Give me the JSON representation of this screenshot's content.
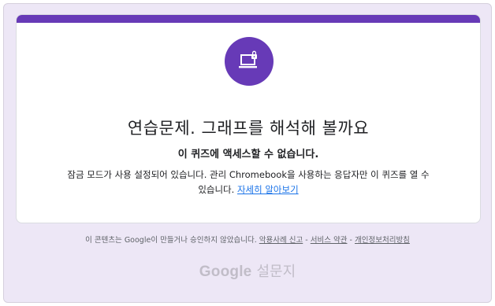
{
  "card": {
    "icon": "locked-laptop-icon",
    "title": "연습문제. 그래프를 해석해 볼까요",
    "subtitle": "이 퀴즈에 액세스할 수 없습니다.",
    "body_line1": "잠금 모드가 사용 설정되어 있습니다. 관리 Chromebook을 사용하는 응답자만 이 퀴즈를 열 수",
    "body_line2_prefix": "있습니다.",
    "learn_more": "자세히 알아보기"
  },
  "footer": {
    "notice": "이 콘텐츠는 Google이 만들거나 승인하지 않았습니다.",
    "report_abuse": "악용사례 신고",
    "sep1": "-",
    "terms": "서비스 약관",
    "sep2": "-",
    "privacy": "개인정보처리방침"
  },
  "brand": {
    "google": "Google",
    "forms": "설문지"
  },
  "colors": {
    "accent": "#673ab7",
    "background": "#ede7f6",
    "link": "#1a73e8"
  }
}
